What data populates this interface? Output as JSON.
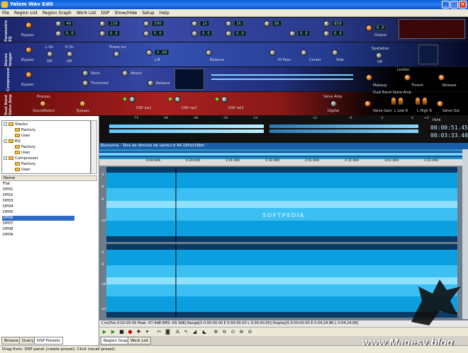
{
  "window": {
    "title": "Yalom Wav Edit",
    "buttons": [
      "_",
      "□",
      "×"
    ]
  },
  "menu": [
    "File",
    "Region List",
    "Region Graph",
    "Work List",
    "DSP",
    "Show/Hide",
    "Setup",
    "Help"
  ],
  "rack": {
    "eq": {
      "label": "Parametric EQ",
      "bypass": "Bypass",
      "bands": [
        {
          "freq": "40",
          "gain": "0.0"
        },
        {
          "freq": "150",
          "gain": "0.0"
        },
        {
          "freq": "500",
          "gain": "0.0"
        },
        {
          "freq": "1k",
          "gain": "0.0"
        },
        {
          "freq": "3k",
          "gain": "0.0"
        },
        {
          "freq": "8k",
          "gain": "0.0"
        },
        {
          "freq": "850",
          "gain": "0.0"
        }
      ],
      "output": "Output",
      "output_val": "0.0"
    },
    "stereo": {
      "label": "Stereo Imager",
      "bypass": "Bypass",
      "lon": "L On",
      "ron": "R On",
      "l_off": "Off",
      "r_off": "Off",
      "phase": "Phase Inv",
      "lr": "L/R",
      "lr_val": "0.00",
      "balance": "Balance",
      "hipass": "Hi Pass",
      "center": "Center",
      "side": "Side",
      "spatialize": "Spatialize",
      "spat_off": "Off"
    },
    "comp": {
      "label": "Compressor",
      "bypass": "Bypass",
      "ratio": "Ratio",
      "threshold": "Threshold",
      "attack": "Attack",
      "release": "Release",
      "makeup": "Makeup",
      "limiter": "Limiter",
      "limiter_thresh": "Thresh",
      "limiter_release": "Release"
    },
    "valve": {
      "label": "Dual Band Valve Amp",
      "process": "Process",
      "sound_select": "SoundSelect",
      "bypass": "Bypass",
      "dsp1": "DSP sw1",
      "dsp2": "DSP sw2",
      "dsp3": "DSP sw3",
      "valve_amp": "Valve Amp",
      "digital": "Digital",
      "valve_gain": "Valve Gain",
      "lpf": "L Low R",
      "hpf": "L High R",
      "valve_out": "Valve Out"
    }
  },
  "meters": {
    "scale": [
      "-72",
      "-60",
      "-48",
      "-36",
      "-24",
      "-12",
      "-6",
      "-3",
      "0",
      "+3"
    ],
    "peak_label": "PEAK"
  },
  "clock": {
    "line1": "00:00:51.45",
    "line2": "00:03:33.40"
  },
  "tree": [
    {
      "name": "Stacks",
      "level": 0,
      "expand": "-"
    },
    {
      "name": "Factory",
      "level": 1
    },
    {
      "name": "User",
      "level": 1
    },
    {
      "name": "EQ",
      "level": 0,
      "expand": "-"
    },
    {
      "name": "Factory",
      "level": 1
    },
    {
      "name": "User",
      "level": 1
    },
    {
      "name": "Compressor",
      "level": 0,
      "expand": "-"
    },
    {
      "name": "Factory",
      "level": 1
    },
    {
      "name": "User",
      "level": 1
    }
  ],
  "preset_header": "Name",
  "presets": [
    "Flat",
    "DP01",
    "DP02",
    "DP03",
    "DP04",
    "DP05",
    "DP06",
    "DP07",
    "DP08",
    "DP09"
  ],
  "selected_preset": "DP06",
  "bottom_tabs": [
    "Browse",
    "Query",
    "DSP Presets"
  ],
  "editor": {
    "file_title": "Bucovina - Tara de dincolo de vantul d 44.1KHz/16bit",
    "ruler": [
      "0:00:000",
      "0:30:000",
      "1:01:000",
      "1:31:000",
      "2:01:000",
      "2:31:000",
      "3:01:000",
      "3:31:000"
    ],
    "db_scale": [
      "-3",
      "-6",
      "-9",
      "-12",
      "-18",
      "-24",
      "-30",
      "-inf"
    ],
    "info": "Crsr[Pos 0:02:00.00 Peak -07.4dB RMS -09.3dB] Range[S 0:00:00.00 E 0:00:00.00 L 0:00:00.00] Display[S 0:00:00.00 E 0:04:24.86 L 0:04:24.86]",
    "tabs": [
      "Region Graph",
      "Work List"
    ],
    "softpedia": "SOFTPEDIA"
  },
  "status": "Drag from: DSP panel (create preset). Click (recall preset).",
  "watermark": "www.Magesy.blog",
  "colors": {
    "eq_panel": "#2a3a8c",
    "stereo_panel": "#243c90",
    "comp_panel": "#1f2f7a",
    "valve_panel": "#8a1818",
    "wave_fill": "#0b9fe0",
    "wave_dark": "#0a3a66"
  }
}
